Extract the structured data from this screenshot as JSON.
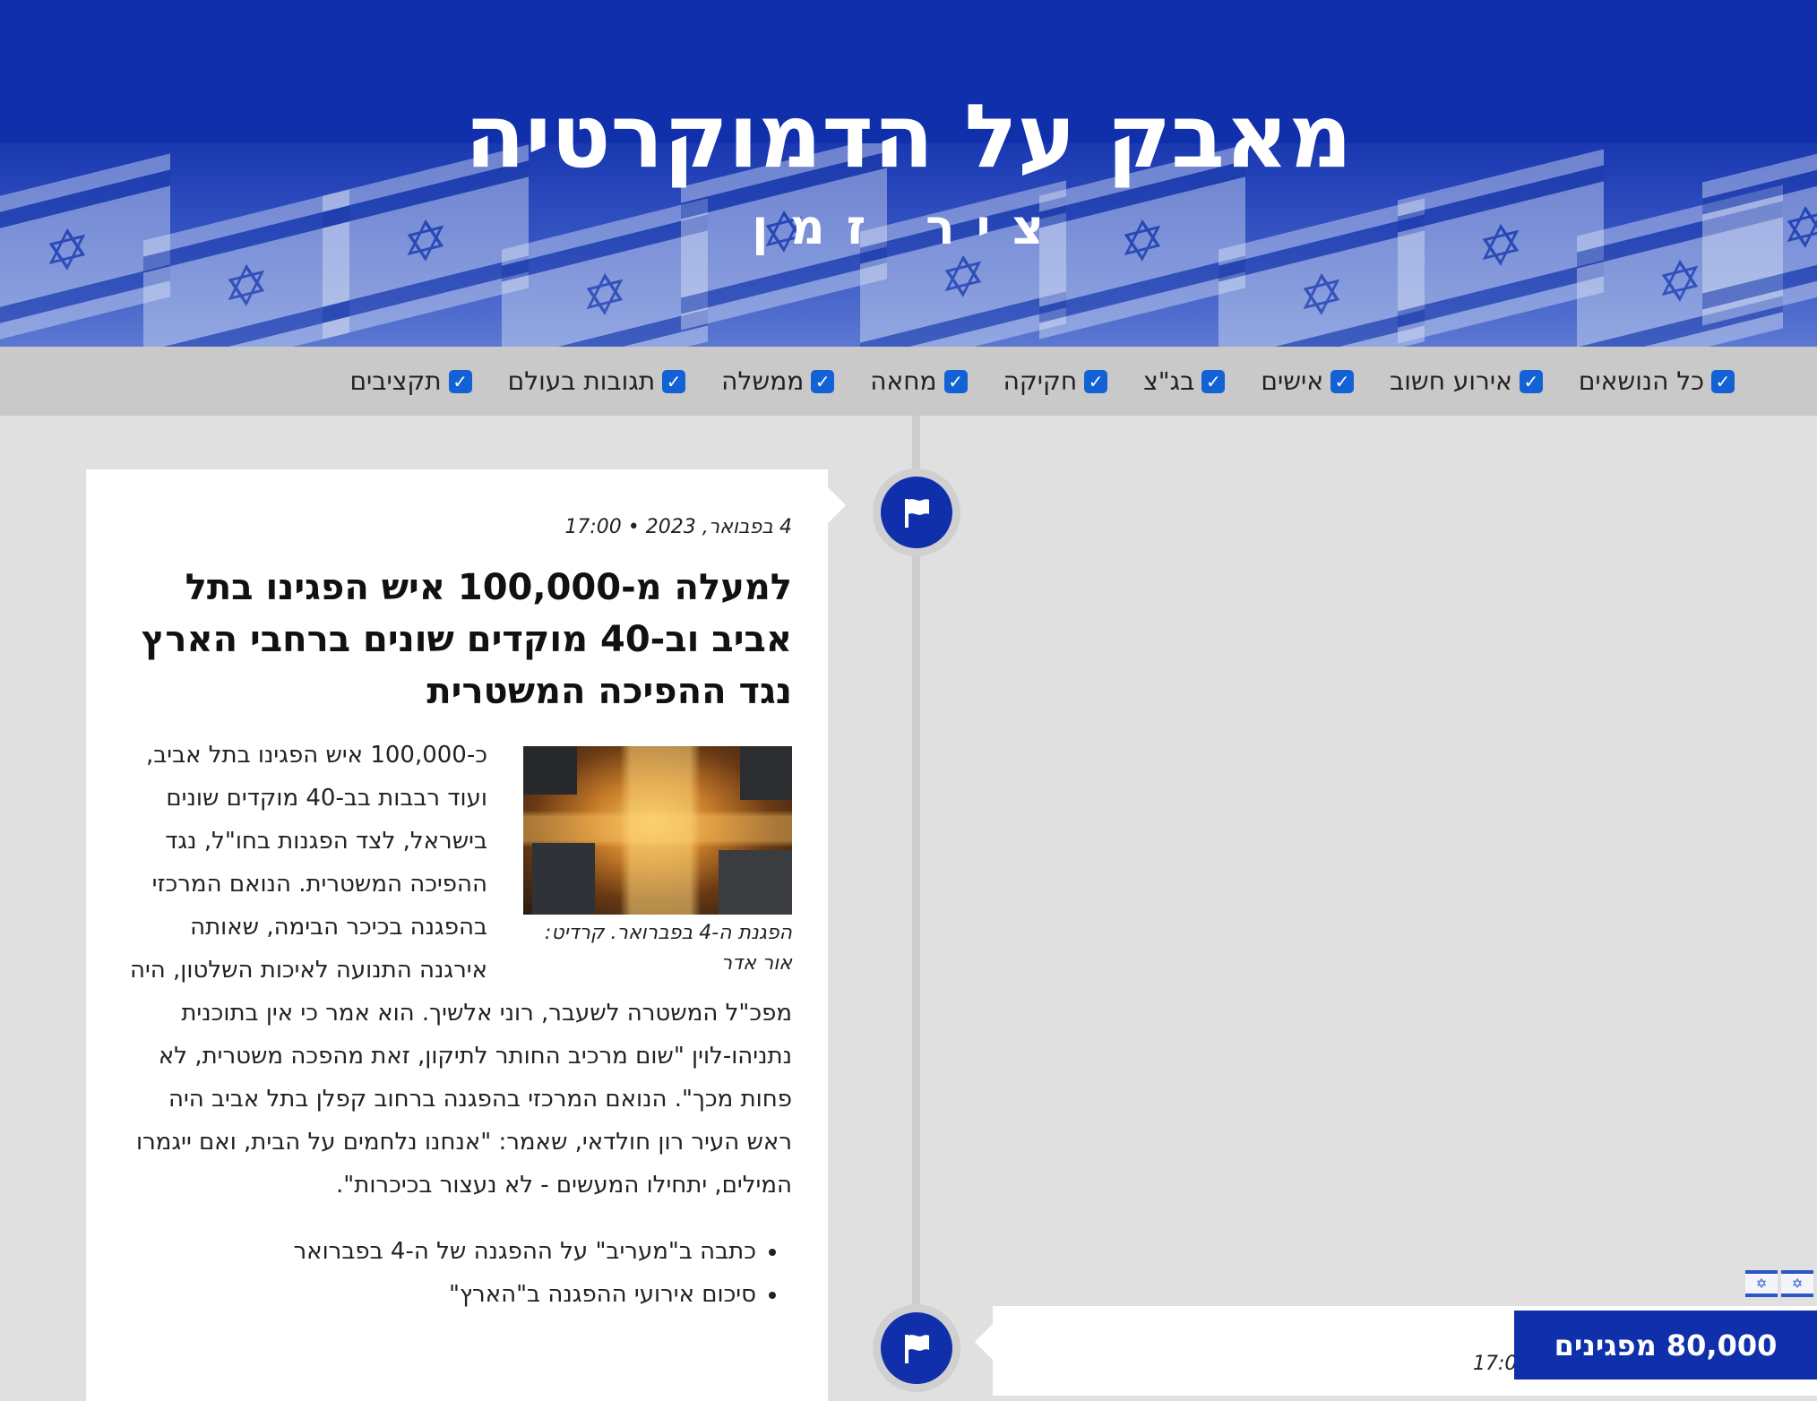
{
  "header": {
    "title": "מאבק על הדמוקרטיה",
    "subtitle": "ציר זמן"
  },
  "filters": [
    {
      "label": "כל הנושאים",
      "checked": true
    },
    {
      "label": "אירוע חשוב",
      "checked": true
    },
    {
      "label": "אישים",
      "checked": true
    },
    {
      "label": "בג\"צ",
      "checked": true
    },
    {
      "label": "חקיקה",
      "checked": true
    },
    {
      "label": "מחאה",
      "checked": true
    },
    {
      "label": "ממשלה",
      "checked": true
    },
    {
      "label": "תגובות בעולם",
      "checked": true
    },
    {
      "label": "תקציבים",
      "checked": true
    }
  ],
  "timeline": {
    "node_icon": "flag-icon",
    "events": [
      {
        "date": "4 בפבואר, 2023 • 17:00",
        "title": "למעלה מ-100,000 איש הפגינו בתל אביב וב-40 מוקדים שונים ברחבי הארץ נגד ההפיכה המשטרית",
        "body": "כ-100,000 איש הפגינו בתל אביב, ועוד רבבות בב-40 מוקדים שונים בישראל, לצד הפגנות בחו\"ל, נגד ההפיכה המשטרית. הנואם המרכזי בהפגנה בכיכר הבימה, שאותה אירגנה התנועה לאיכות השלטון, היה מפכ\"ל המשטרה לשעבר, רוני אלשיך. הוא אמר כי אין בתוכנית נתניהו-לוין \"שום מרכיב החותר לתיקון, זאת מהפכה משטרית, לא פחות מכך\". הנואם המרכזי בהפגנה ברחוב קפלן בתל אביב היה ראש העיר רון חולדאי, שאמר: \"אנחנו נלחמים על הבית, ואם ייגמרו המילים, יתחילו המעשים - לא נעצור בכיכרות\".",
        "image_caption": "הפגנת ה-4 בפברואר. קרדיט: אור אדר",
        "links": [
          "כתבה ב\"מעריב\" על ההפגנה של ה-4 בפברואר",
          "סיכום אירועי ההפגנה ב\"הארץ\""
        ]
      },
      {
        "date": "17:0"
      }
    ]
  },
  "protesters_badge": {
    "label": "80,000 מפגינים"
  },
  "colors": {
    "primary": "#0f2fab",
    "background": "#e0e0e0",
    "filter_bar": "#c9c9c9",
    "checkbox": "#1262d6"
  }
}
